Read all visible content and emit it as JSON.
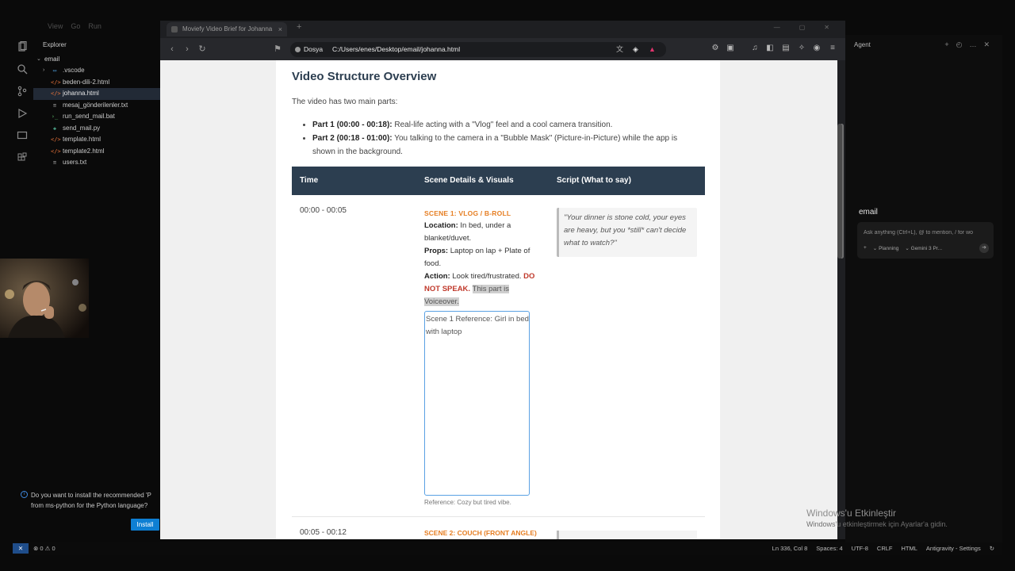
{
  "menubar": {
    "items": [
      "View",
      "Go",
      "Run"
    ]
  },
  "explorer": {
    "title": "Explorer",
    "root": "email",
    "items": [
      {
        "name": ".vscode",
        "type": "folder"
      },
      {
        "name": "beden-dili-2.html",
        "type": "html"
      },
      {
        "name": "johanna.html",
        "type": "html",
        "active": true
      },
      {
        "name": "mesaj_gönderilenler.txt",
        "type": "txt"
      },
      {
        "name": "run_send_mail.bat",
        "type": "bat"
      },
      {
        "name": "send_mail.py",
        "type": "py"
      },
      {
        "name": "template.html",
        "type": "html"
      },
      {
        "name": "template2.html",
        "type": "html"
      },
      {
        "name": "users.txt",
        "type": "txt"
      }
    ]
  },
  "notification": {
    "message": "Do you want to install the recommended 'P... from ms-python for the Python language?",
    "line1": "Do you want to install the recommended 'P",
    "line2": "from ms-python for the Python language?",
    "install_label": "Install"
  },
  "browser": {
    "tab_title": "Moviefy Video Brief for Johanna",
    "site_label": "Dosya",
    "url": "C:/Users/enes/Desktop/email/johanna.html"
  },
  "document": {
    "heading": "Video Structure Overview",
    "intro": "The video has two main parts:",
    "parts": [
      {
        "label": "Part 1 (00:00 - 00:18):",
        "text": " Real-life acting with a \"Vlog\" feel and a cool camera transition."
      },
      {
        "label": "Part 2 (00:18 - 01:00):",
        "text": " You talking to the camera in a \"Bubble Mask\" (Picture-in-Picture) while the app is shown in the background."
      }
    ],
    "table_headers": {
      "time": "Time",
      "scene": "Scene Details & Visuals",
      "script": "Script (What to say)"
    },
    "rows": [
      {
        "time": "00:00 - 00:05",
        "scene_title": "SCENE 1: VLOG / B-ROLL",
        "location_label": "Location:",
        "location": " In bed, under a blanket/duvet.",
        "props_label": "Props:",
        "props": " Laptop on lap + Plate of food.",
        "action_label": "Action:",
        "action": " Look tired/frustrated. ",
        "warning": "DO NOT SPEAK.",
        "highlight": "This part is Voiceover.",
        "image_alt": "Scene 1 Reference: Girl in bed with laptop",
        "caption": "Reference: Cozy but tired vibe.",
        "script": "\"Your dinner is stone cold, your eyes are heavy, but you *still* can't decide what to watch?\""
      },
      {
        "time": "00:05 - 00:12",
        "scene_title": "SCENE 2: COUCH (FRONT ANGLE)"
      }
    ]
  },
  "agent": {
    "title": "Agent",
    "workspace": "email",
    "placeholder": "Ask anything (Ctrl+L), @ to mention, / for wo",
    "mode": "Planning",
    "model": "Gemini 3 Pr..."
  },
  "watermark": {
    "line1": "Windows'u Etkinleştir",
    "line2": "Windows'u etkinleştirmek için Ayarlar'a gidin."
  },
  "statusbar": {
    "errors": "0",
    "warnings": "0",
    "position": "Ln 336, Col 8",
    "spaces": "Spaces: 4",
    "encoding": "UTF-8",
    "eol": "CRLF",
    "language": "HTML",
    "settings": "Antigravity - Settings"
  }
}
